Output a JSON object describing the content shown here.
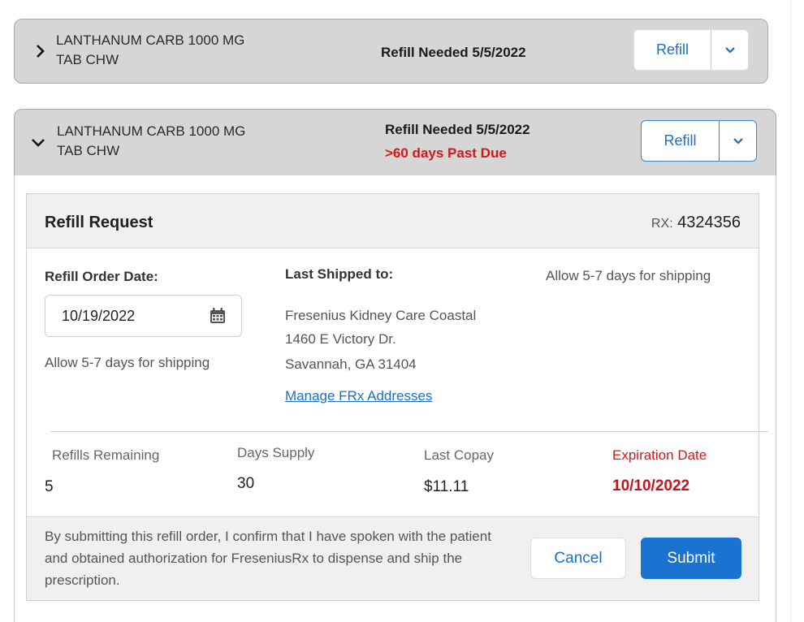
{
  "prescriptions": [
    {
      "drug_line1": "LANTHANUM CARB 1000 MG",
      "drug_line2": "TAB CHW",
      "refill_needed": "Refill Needed 5/5/2022",
      "refill_button": "Refill",
      "expanded": false
    },
    {
      "drug_line1": "LANTHANUM CARB 1000 MG",
      "drug_line2": "TAB CHW",
      "refill_needed": "Refill Needed 5/5/2022",
      "past_due": ">60 days Past Due",
      "refill_button": "Refill",
      "expanded": true
    }
  ],
  "refill_request": {
    "title": "Refill Request",
    "rx_label": "RX:",
    "rx_number": "4324356",
    "order_date_label": "Refill Order Date:",
    "order_date_value": "10/19/2022",
    "order_date_hint": "Allow 5-7 days for shipping",
    "last_shipped_label": "Last Shipped to:",
    "address_line1": "Fresenius Kidney Care Coastal",
    "address_line2": "1460 E Victory Dr.",
    "address_line3": "Savannah, GA 31404",
    "manage_addresses_link": "Manage FRx Addresses",
    "shipping_note": "Allow 5-7 days for shipping",
    "stats": {
      "refills_remaining_label": "Refills Remaining",
      "refills_remaining_value": "5",
      "days_supply_label": "Days Supply",
      "days_supply_value": "30",
      "last_copay_label": "Last Copay",
      "last_copay_value": "$11.11",
      "expiration_label": "Expiration Date",
      "expiration_value": "10/10/2022"
    },
    "consent_text": "By submitting this refill order, I confirm that I have spoken with the patient and obtained authorization for FreseniusRx to dispense and ship the prescription.",
    "cancel_button": "Cancel",
    "submit_button": "Submit"
  },
  "icons": {
    "collapsed": "chevron-right-icon",
    "expanded": "chevron-down-icon",
    "dropdown": "caret-down-icon",
    "date_picker": "calendar-icon"
  },
  "colors": {
    "accent": "#1a73d0",
    "link": "#1c6fc9",
    "alert": "#d41818",
    "card_bg": "#d6d6d6",
    "panel_bg": "#f0f0f0"
  }
}
